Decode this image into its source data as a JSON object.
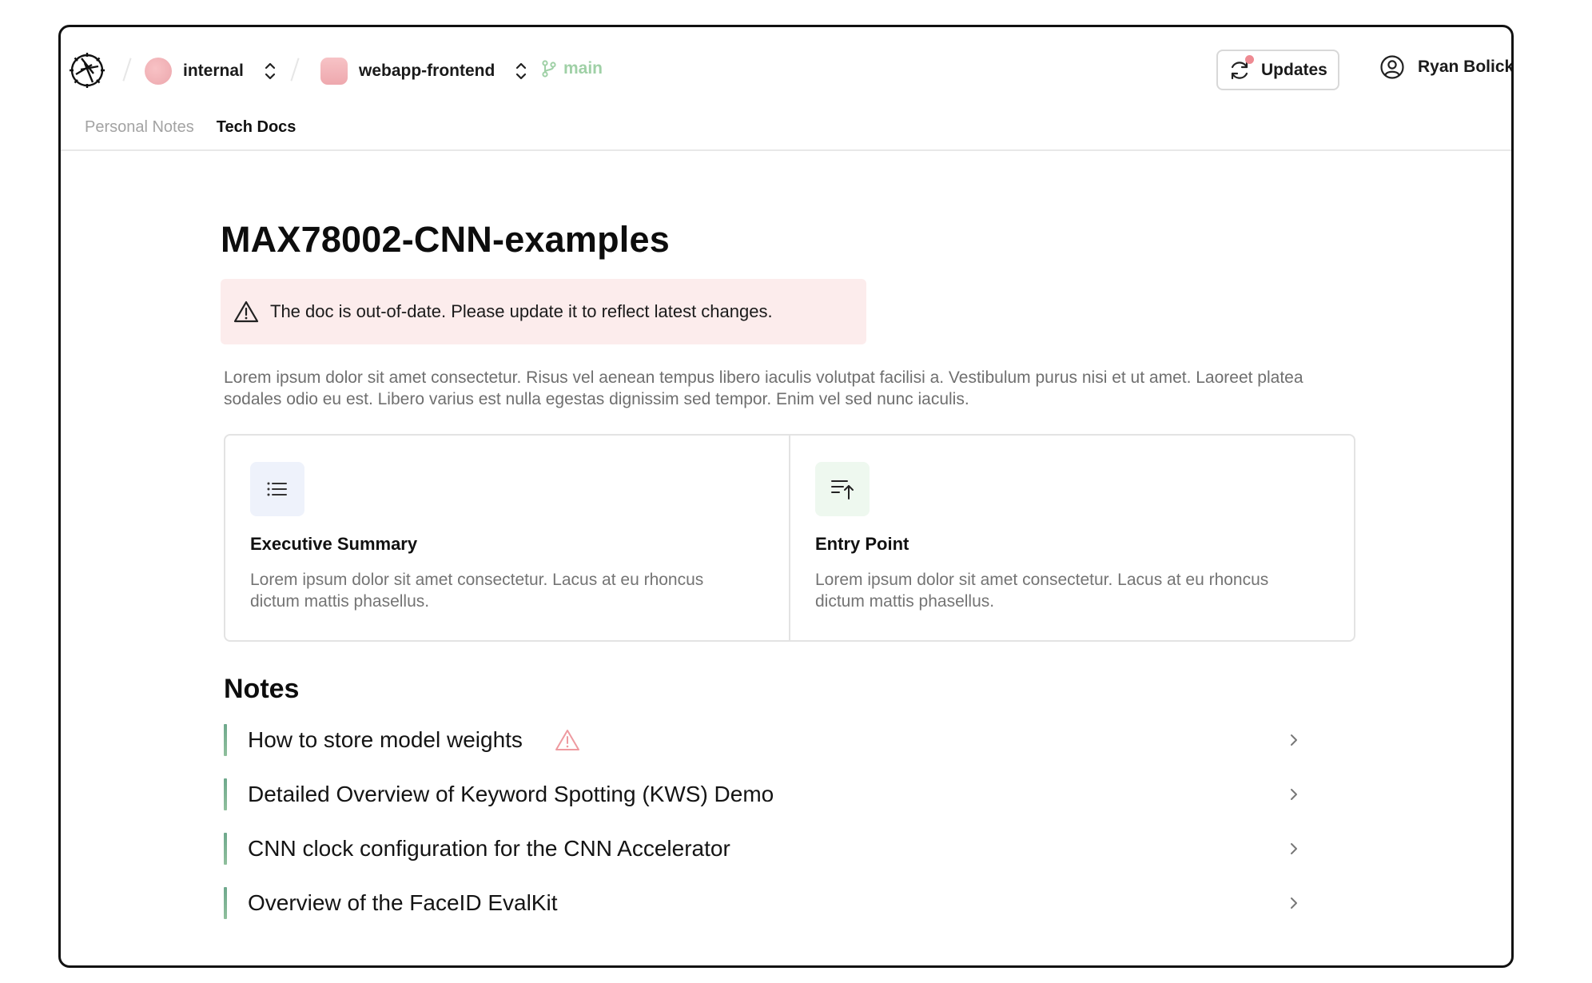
{
  "header": {
    "org": {
      "label": "internal"
    },
    "repo": {
      "label": "webapp-frontend"
    },
    "branch": {
      "label": "main"
    },
    "updates_label": "Updates",
    "user_name": "Ryan Bolick"
  },
  "tabs": [
    {
      "label": "Personal Notes",
      "active": false
    },
    {
      "label": "Tech Docs",
      "active": true
    }
  ],
  "page": {
    "title": "MAX78002-CNN-examples",
    "alert": "The doc is out-of-date. Please update it to reflect latest changes.",
    "intro": "Lorem ipsum dolor sit amet consectetur. Risus vel aenean tempus libero iaculis volutpat facilisi a. Vestibulum purus nisi et ut amet. Laoreet platea sodales odio eu est. Libero varius est nulla egestas dignissim sed tempor. Enim vel sed nunc iaculis."
  },
  "cards": [
    {
      "icon": "list-icon",
      "title": "Executive Summary",
      "desc": "Lorem ipsum dolor sit amet consectetur. Lacus at eu rhoncus dictum mattis phasellus."
    },
    {
      "icon": "sort-ascending-icon",
      "title": "Entry Point",
      "desc": "Lorem ipsum dolor sit amet consectetur. Lacus at eu rhoncus dictum mattis phasellus."
    }
  ],
  "notes": {
    "heading": "Notes",
    "items": [
      {
        "title": "How to store model weights",
        "warning": true
      },
      {
        "title": "Detailed Overview of Keyword Spotting (KWS) Demo",
        "warning": false
      },
      {
        "title": "CNN clock configuration for the CNN Accelerator",
        "warning": false
      },
      {
        "title": "Overview of the FaceID EvalKit",
        "warning": false
      }
    ]
  },
  "colors": {
    "alert_bg": "#fcecec",
    "warning_accent": "#ee9aa0",
    "branch_green": "#9fd0a6",
    "note_bar": "#6ea88c",
    "org_avatar": "#eca7ad"
  }
}
